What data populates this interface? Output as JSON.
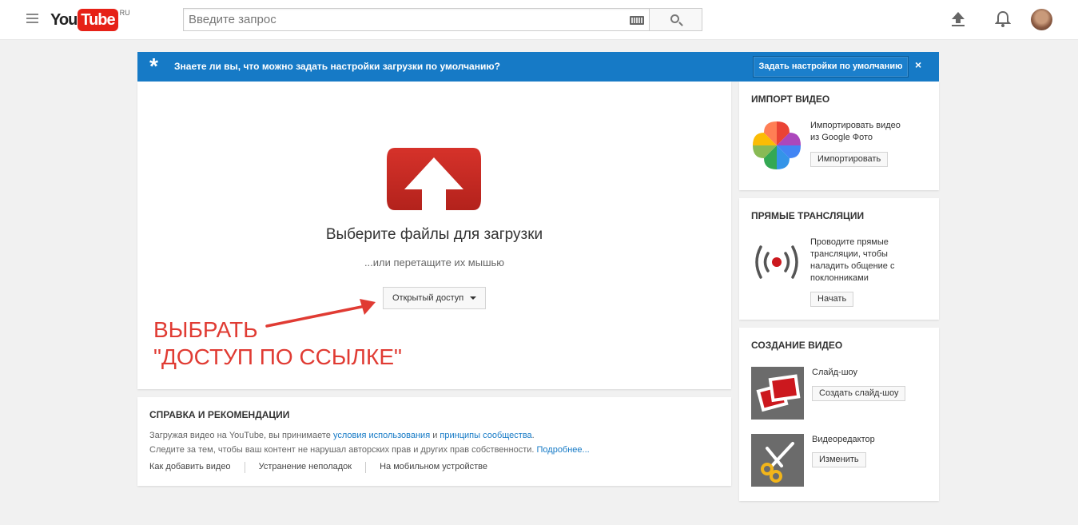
{
  "header": {
    "logo_you": "You",
    "logo_tube": "Tube",
    "logo_region": "RU",
    "search_placeholder": "Введите запрос"
  },
  "banner": {
    "star": "*",
    "text": "Знаете ли вы, что можно задать настройки загрузки по умолчанию?",
    "button": "Задать настройки по умолчанию",
    "close": "×"
  },
  "upload": {
    "title": "Выберите файлы для загрузки",
    "subtitle": "...или перетащите их мышью",
    "privacy_selected": "Открытый доступ",
    "annotation_line1": "ВЫБРАТЬ",
    "annotation_line2": "\"ДОСТУП ПО ССЫЛКЕ\""
  },
  "help": {
    "title": "СПРАВКА И РЕКОМЕНДАЦИИ",
    "line1_prefix": "Загружая видео на YouTube, вы принимаете ",
    "line1_link1": "условия использования",
    "line1_mid": " и ",
    "line1_link2": "принципы сообщества",
    "line1_suffix": ".",
    "line2_text": "Следите за тем, чтобы ваш контент не нарушал авторских прав и других прав собственности. ",
    "line2_link": "Подробнее...",
    "links": [
      "Как добавить видео",
      "Устранение неполадок",
      "На мобильном устройстве"
    ]
  },
  "import": {
    "title": "ИМПОРТ ВИДЕО",
    "text_line1": "Импортировать видео",
    "text_line2": "из Google Фото",
    "button": "Импортировать"
  },
  "live": {
    "title": "ПРЯМЫЕ ТРАНСЛЯЦИИ",
    "text_lines": [
      "Проводите прямые",
      "трансляции, чтобы",
      "наладить общение с",
      "поклонниками"
    ],
    "button": "Начать"
  },
  "create": {
    "title": "СОЗДАНИЕ ВИДЕО",
    "slideshow_label": "Слайд-шоу",
    "slideshow_button": "Создать слайд-шоу",
    "editor_label": "Видеоредактор",
    "editor_button": "Изменить"
  },
  "colors": {
    "brand_red": "#e62117",
    "banner_blue": "#167ac6",
    "annotation_red": "#e03b33",
    "link_blue": "#167ac6"
  }
}
